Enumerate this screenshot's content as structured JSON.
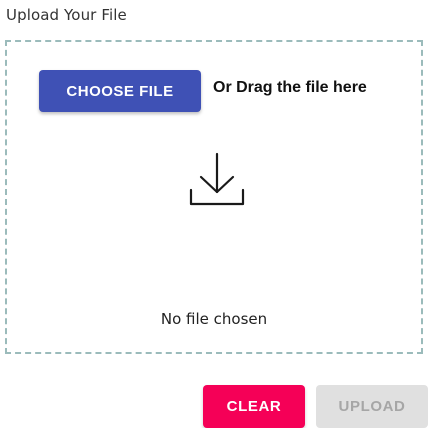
{
  "upload": {
    "title": "Upload Your File",
    "choose_label": "CHOOSE FILE",
    "drag_text": "Or Drag the file here",
    "status": "No file chosen",
    "upload_icon": "download-icon"
  },
  "actions": {
    "clear_label": "CLEAR",
    "upload_label": "UPLOAD",
    "upload_disabled": true
  },
  "colors": {
    "primary": "#3f51b5",
    "secondary": "#f50057",
    "disabled_bg": "#e0e0e0",
    "disabled_text": "#a6a6a6",
    "dashed_border": "#9bbbbb"
  }
}
